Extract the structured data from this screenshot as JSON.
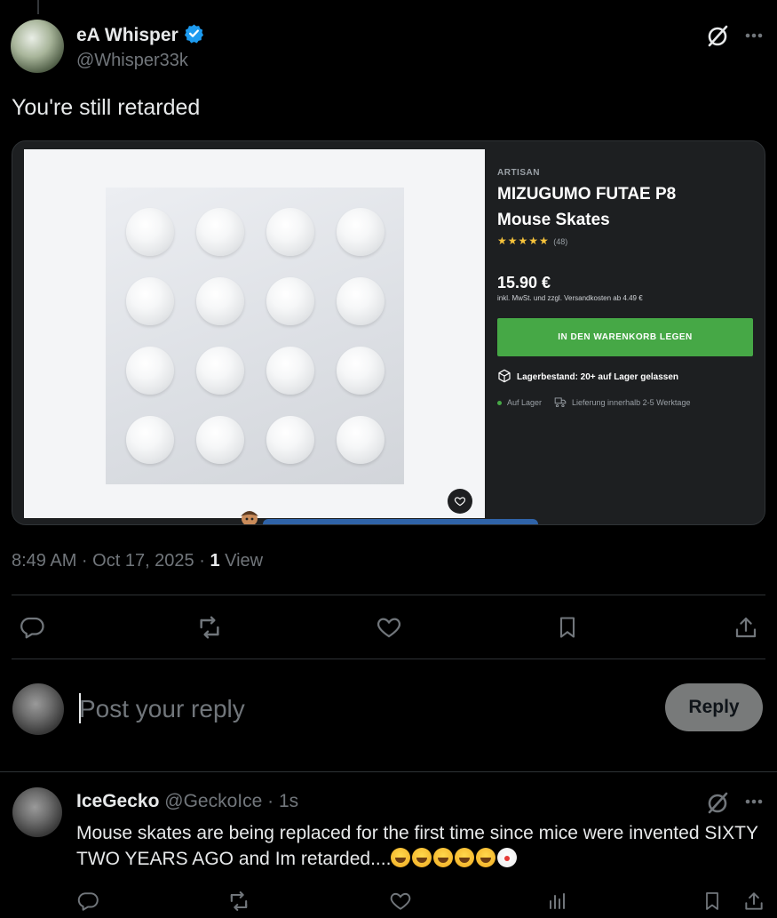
{
  "tweet": {
    "author_name": "eA Whisper",
    "author_handle": "@Whisper33k",
    "text": "You're still retarded",
    "timestamp": "8:49 AM · Oct 17, 2025 · ",
    "views_count": "1",
    "views_label": " View"
  },
  "media": {
    "brand": "ARTISAN",
    "title_line1": "MIZUGUMO FUTAE P8",
    "title_line2": "Mouse Skates",
    "stars": "★★★★★",
    "rating": 5,
    "review_count": "(48)",
    "price": "15.90 €",
    "tax_note": "inkl. MwSt. und zzgl. Versandkosten ab 4.49 €",
    "cart_button": "IN DEN WARENKORB LEGEN",
    "stock": "Lagerbestand: 20+ auf Lager gelassen",
    "availability": "Auf Lager",
    "delivery": "Lieferung innerhalb 2-5 Werktage",
    "skate_count": 16
  },
  "reply_box": {
    "placeholder": "Post your reply",
    "button": "Reply"
  },
  "comment": {
    "author_name": "IceGecko",
    "author_handle": "@GeckoIce",
    "time": " · 1s",
    "text": "Mouse skates are being replaced for the first time since mice were invented SIXTY TWO YEARS AGO and Im retarded....",
    "emojis": [
      "rofl",
      "rofl",
      "rofl",
      "rofl",
      "rofl",
      "clown"
    ]
  },
  "icons": {
    "verified": "verified-badge-icon",
    "grok": "grok-icon",
    "more": "more-icon",
    "reply": "reply-icon",
    "retweet": "retweet-icon",
    "like": "heart-icon",
    "bookmark": "bookmark-icon",
    "share": "share-icon",
    "views": "views-icon"
  },
  "colors": {
    "background": "#000000",
    "text": "#e7e9ea",
    "muted": "#71767b",
    "divider": "#2f3336",
    "verified": "#1d9bf0",
    "cart_green": "#46a846",
    "reply_button": "#787a7a"
  }
}
